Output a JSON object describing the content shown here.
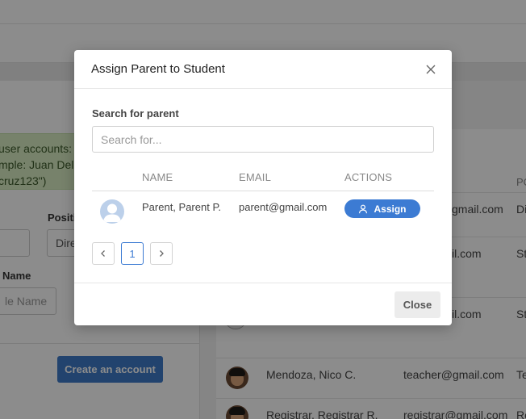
{
  "background": {
    "note_lines": [
      "user accounts: \"",
      "mple: Juan Dela",
      "cruz123\")"
    ],
    "position_label": "Positi",
    "position_value": "Dire",
    "name_label": "Name",
    "name_placeholder": "le Name",
    "create_button": "Create an account",
    "column_header_partial": "PO",
    "rows": [
      {
        "email": "gmail.com",
        "position": "Di"
      },
      {
        "email": "il.com",
        "position": "St"
      },
      {
        "email": "il.com",
        "position": "St"
      },
      {
        "name": "Mendoza, Nico C.",
        "email": "teacher@gmail.com",
        "position": "Te"
      },
      {
        "name": "Registrar, Registrar R.",
        "email": "registrar@gmail.com",
        "position": "Re"
      }
    ]
  },
  "modal": {
    "title": "Assign Parent to Student",
    "search_label": "Search for parent",
    "search_placeholder": "Search for...",
    "columns": [
      "NAME",
      "EMAIL",
      "ACTIONS"
    ],
    "results": [
      {
        "name": "Parent, Parent P.",
        "email": "parent@gmail.com",
        "action_label": "Assign"
      }
    ],
    "pagination": {
      "prev": "‹",
      "current": "1",
      "next": "›"
    },
    "close_label": "Close"
  },
  "colors": {
    "primary": "#3c7bd3",
    "overlay": "rgba(0,0,0,0.45)",
    "note_bg": "#d9edc4"
  }
}
